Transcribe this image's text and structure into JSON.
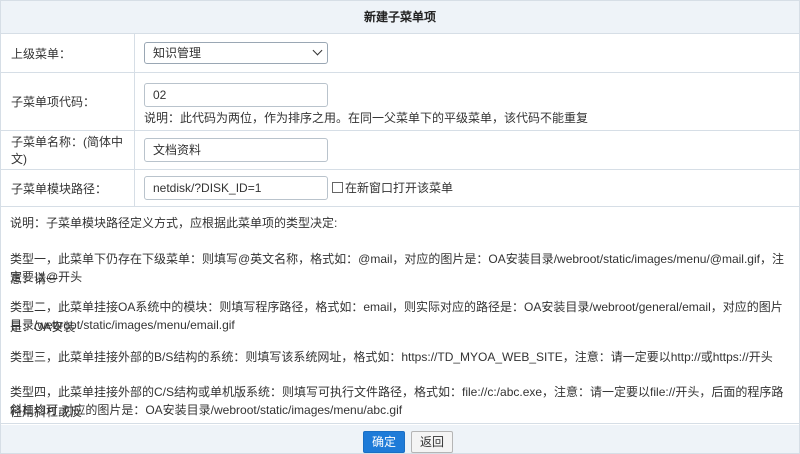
{
  "form": {
    "title": "新建子菜单项",
    "parent_menu": {
      "label": "上级菜单：",
      "selected": "知识管理"
    },
    "item_code": {
      "label": "子菜单项代码：",
      "value": "02",
      "hint": "说明：此代码为两位，作为排序之用。在同一父菜单下的平级菜单，该代码不能重复"
    },
    "item_name": {
      "label": "子菜单名称：(简体中文)",
      "value": "文档资料"
    },
    "module_path": {
      "label": "子菜单模块路径：",
      "value": "netdisk/?DISK_ID=1",
      "new_window_label": "在新窗口打开该菜单",
      "new_window_checked": false
    }
  },
  "notes": {
    "intro": "说明：子菜单模块路径定义方式，应根据此菜单项的类型决定:",
    "type1_line1": "类型一，此菜单下仍存在下级菜单：则填写@英文名称，格式如：@mail，对应的图片是：OA安装目录/webroot/static/images/menu/@mail.gif，注意：请一",
    "type1_line2": "定要以@开头",
    "type2_line1": "类型二，此菜单挂接OA系统中的模块：则填写程序路径，格式如：email，则实际对应的路径是：OA安装目录/webroot/general/email，对应的图片是：OA安装",
    "type2_line2": "目录/webroot/static/images/menu/email.gif",
    "type3_line1": "类型三，此菜单挂接外部的B/S结构的系统：则填写该系统网址，格式如：https://TD_MYOA_WEB_SITE，注意：请一定要以http://或https://开头",
    "type4_line1": "类型四，此菜单挂接外部的C/S结构或单机版系统：则填写可执行文件路径，格式如：file://c:/abc.exe，注意：请一定要以file://开头，后面的程序路径用斜杠或反",
    "type4_line2": "斜杠均可,对应的图片是：OA安装目录/webroot/static/images/menu/abc.gif"
  },
  "buttons": {
    "ok": "确定",
    "back": "返回"
  }
}
